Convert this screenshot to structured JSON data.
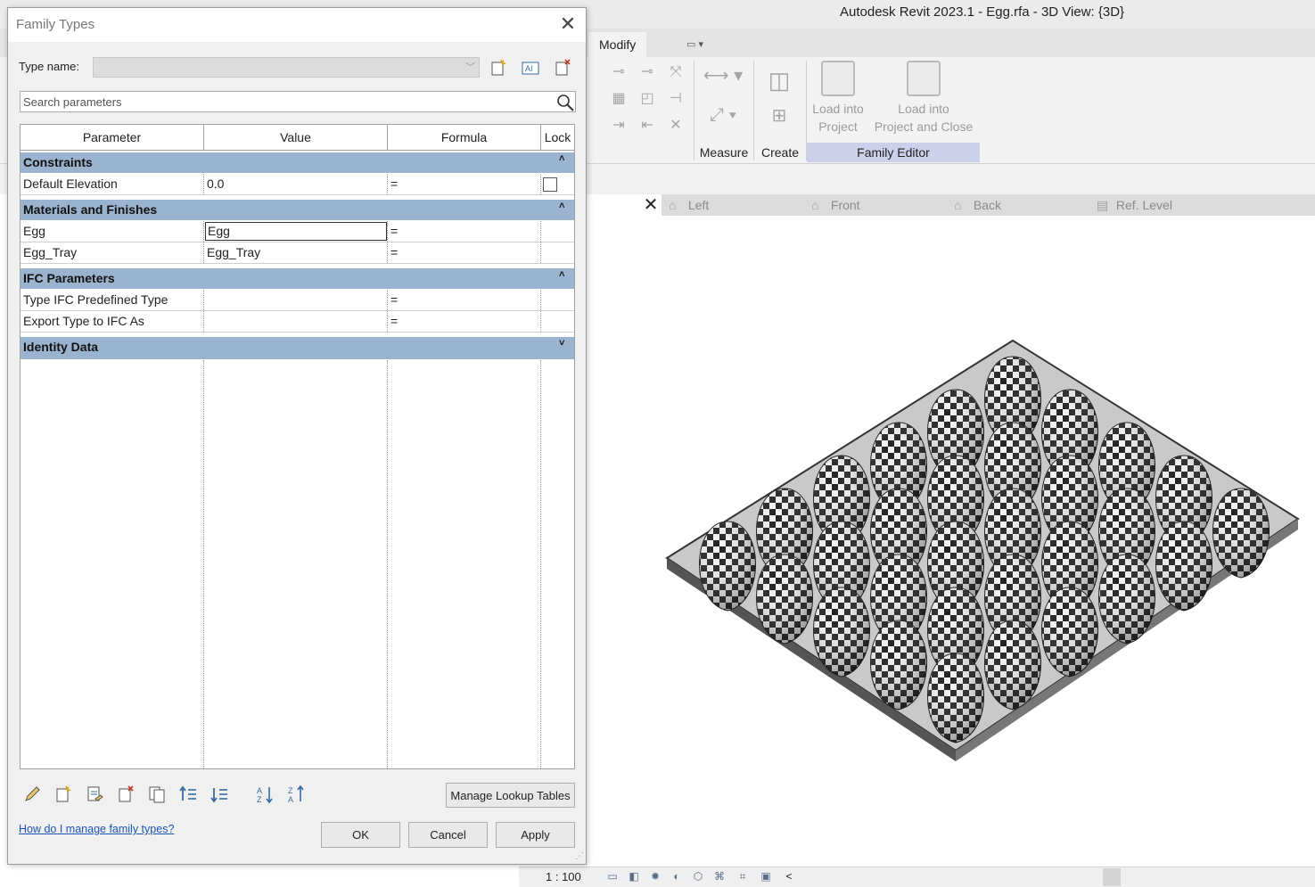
{
  "app": {
    "title": "Autodesk Revit 2023.1 - Egg.rfa - 3D View: {3D}"
  },
  "ribbon": {
    "tabs": [
      {
        "label": "Modify"
      }
    ],
    "panels": {
      "measure": "Measure",
      "create": "Create",
      "family_editor": "Family Editor"
    },
    "buttons": {
      "load_into_project": "Load into\nProject",
      "load_into_project_close": "Load into\nProject and Close"
    }
  },
  "view_tabs": [
    {
      "label": "Left",
      "icon": "house-icon"
    },
    {
      "label": "Front",
      "icon": "house-icon"
    },
    {
      "label": "Back",
      "icon": "house-icon"
    },
    {
      "label": "Ref. Level",
      "icon": "plan-icon"
    }
  ],
  "status": {
    "scale": "1 : 100",
    "collapse_glyph": "<"
  },
  "dialog": {
    "title": "Family Types",
    "close_glyph": "✕",
    "type_name_label": "Type name:",
    "type_name_value": "",
    "search_placeholder": "Search parameters",
    "columns": [
      "Parameter",
      "Value",
      "Formula",
      "Lock"
    ],
    "groups": [
      {
        "name": "Constraints",
        "toggle": "˄",
        "rows": [
          {
            "name": "Default Elevation",
            "value": "0.0",
            "formula": "=",
            "lock": false
          }
        ]
      },
      {
        "name": "Materials and Finishes",
        "toggle": "˄",
        "rows": [
          {
            "name": "Egg",
            "value": "Egg",
            "formula": "=",
            "editing": true
          },
          {
            "name": "Egg_Tray",
            "value": "Egg_Tray",
            "formula": "="
          }
        ]
      },
      {
        "name": "IFC Parameters",
        "toggle": "˄",
        "rows": [
          {
            "name": "Type IFC Predefined Type",
            "value": "",
            "formula": "="
          },
          {
            "name": "Export Type to IFC As",
            "value": "",
            "formula": "="
          }
        ]
      },
      {
        "name": "Identity Data",
        "toggle": "˅",
        "rows": []
      }
    ],
    "manage_lookup_label": "Manage Lookup Tables",
    "help_link": "How do I manage family types?",
    "ok_label": "OK",
    "cancel_label": "Cancel",
    "apply_label": "Apply"
  }
}
